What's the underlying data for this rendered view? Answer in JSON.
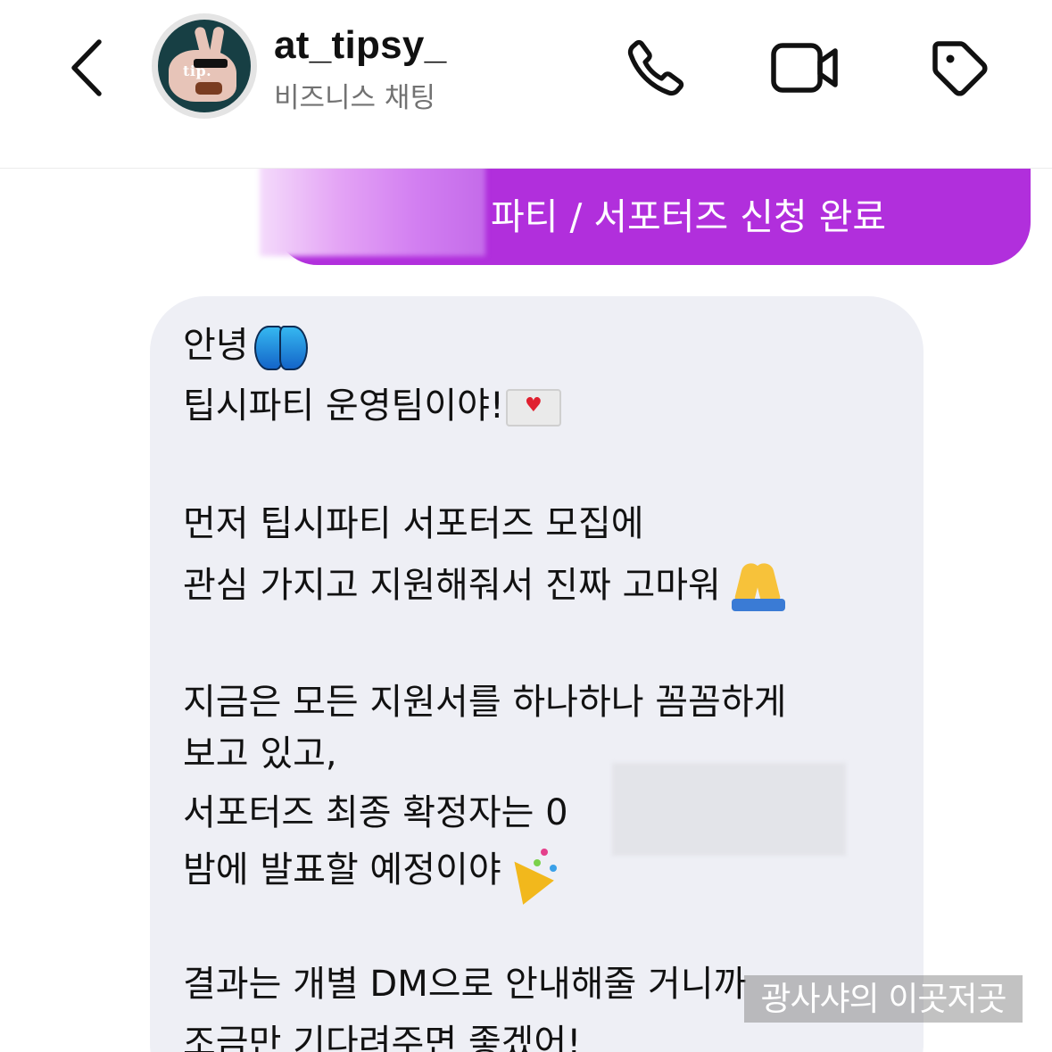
{
  "header": {
    "back_icon": "chevron-left-icon",
    "username": "at_tipsy_",
    "subtitle": "비즈니스 채팅",
    "avatar_logo": "tip.",
    "actions": [
      "phone-icon",
      "video-camera-icon",
      "tag-icon"
    ]
  },
  "thread": {
    "sent_message": "파티 / 서포터즈 신청 완료",
    "received_lines": [
      "안녕",
      "팁시파티 운영팀이야!",
      "먼저 팁시파티 서포터즈 모집에",
      "관심 가지고 지원해줘서 진짜 고마워",
      "지금은 모든 지원서를 하나하나 꼼꼼하게",
      "보고 있고,",
      "서포터즈 최종 확정자는 0",
      "밤에 발표할 예정이야",
      "결과는 개별 DM으로 안내해줄 거니까",
      "조금만 기다려주면 좋겠어!"
    ],
    "emojis": [
      "butterfly",
      "love-letter",
      "folded-hands",
      "party-popper"
    ]
  },
  "watermark": "광사샤의 이곳저곳",
  "colors": {
    "sent_bubble": "#b12fdc",
    "received_bubble": "#eeeff5",
    "subtitle_text": "#727272"
  }
}
